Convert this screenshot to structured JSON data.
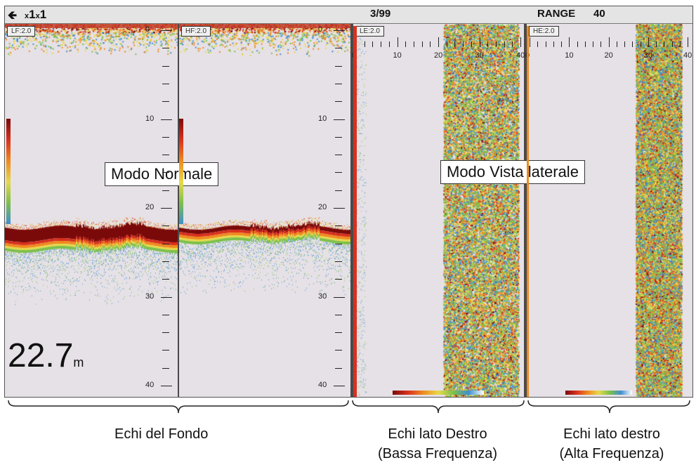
{
  "statusbar": {
    "zoom_a": "1",
    "zoom_b": "1",
    "zoom_prefix": "x",
    "page_indicator": "3/99",
    "range_label": "RANGE",
    "range_value": "40"
  },
  "panels": {
    "lf": {
      "tag": "LF:2.0"
    },
    "hf": {
      "tag": "HF:2.0"
    },
    "le": {
      "tag": "LE:2.0"
    },
    "he": {
      "tag": "HE:2.0"
    }
  },
  "depth_scale": [
    "0",
    "10",
    "20",
    "30",
    "40"
  ],
  "side_scale": [
    "0",
    "10",
    "20",
    "30",
    "40"
  ],
  "overlays": {
    "normal_mode": "Modo Normale",
    "side_mode": "Modo Vista laterale"
  },
  "depth_readout": {
    "value": "22.7",
    "unit": "m"
  },
  "captions": {
    "bottom": "Echi del Fondo",
    "right_low_1": "Echi lato Destro",
    "right_low_2": "(Bassa Frequenza)",
    "right_high_1": "Echi lato destro",
    "right_high_2": "(Alta Frequenza)"
  },
  "colors": {
    "echo_strong": "#7a0a0a",
    "echo_red": "#d9301e",
    "echo_orange": "#ef8a1f",
    "echo_yellow": "#e7d94a",
    "echo_green": "#7cc04a",
    "echo_blue": "#3f8fd0",
    "background": "#e6e1e6"
  }
}
